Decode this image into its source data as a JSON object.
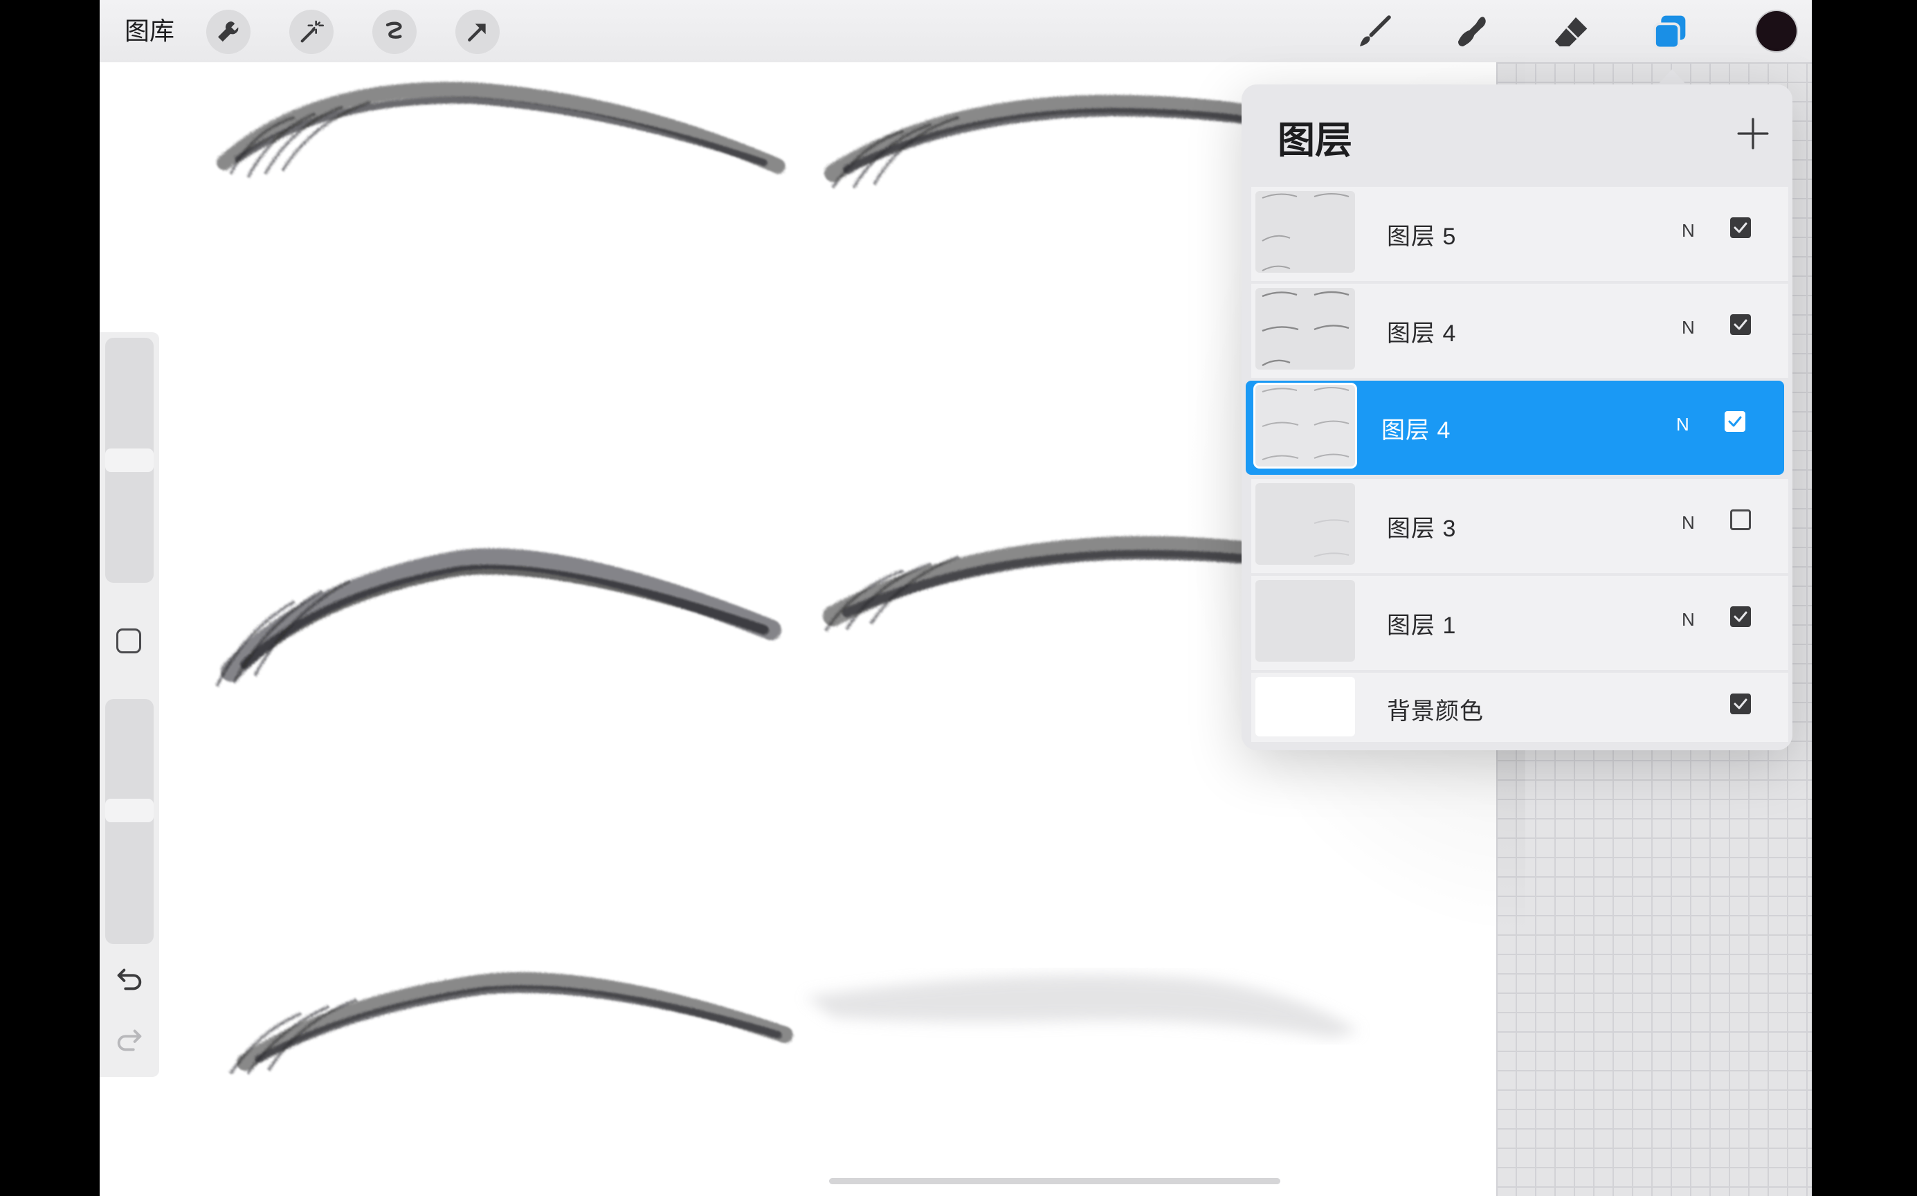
{
  "toolbar": {
    "gallery_label": "图库",
    "left_tools": [
      "wrench-icon",
      "magic-wand-icon",
      "selection-icon",
      "transform-arrow-icon"
    ],
    "right_tools": [
      "brush-icon",
      "smudge-icon",
      "eraser-icon",
      "layers-icon"
    ],
    "active_tool": "layers-icon",
    "current_color": "#1b0f16",
    "accent_color": "#1a8fe6"
  },
  "layers_panel": {
    "title": "图层",
    "add_label": "+",
    "layers": [
      {
        "name": "图层 5",
        "blend": "N",
        "visible": true,
        "selected": false
      },
      {
        "name": "图层 4",
        "blend": "N",
        "visible": true,
        "selected": false
      },
      {
        "name": "图层 4",
        "blend": "N",
        "visible": true,
        "selected": true
      },
      {
        "name": "图层 3",
        "blend": "N",
        "visible": false,
        "selected": false
      },
      {
        "name": "图层 1",
        "blend": "N",
        "visible": true,
        "selected": false
      }
    ],
    "background": {
      "name": "背景颜色",
      "visible": true,
      "color": "#ffffff"
    },
    "selected_color": "#1a99f5"
  }
}
